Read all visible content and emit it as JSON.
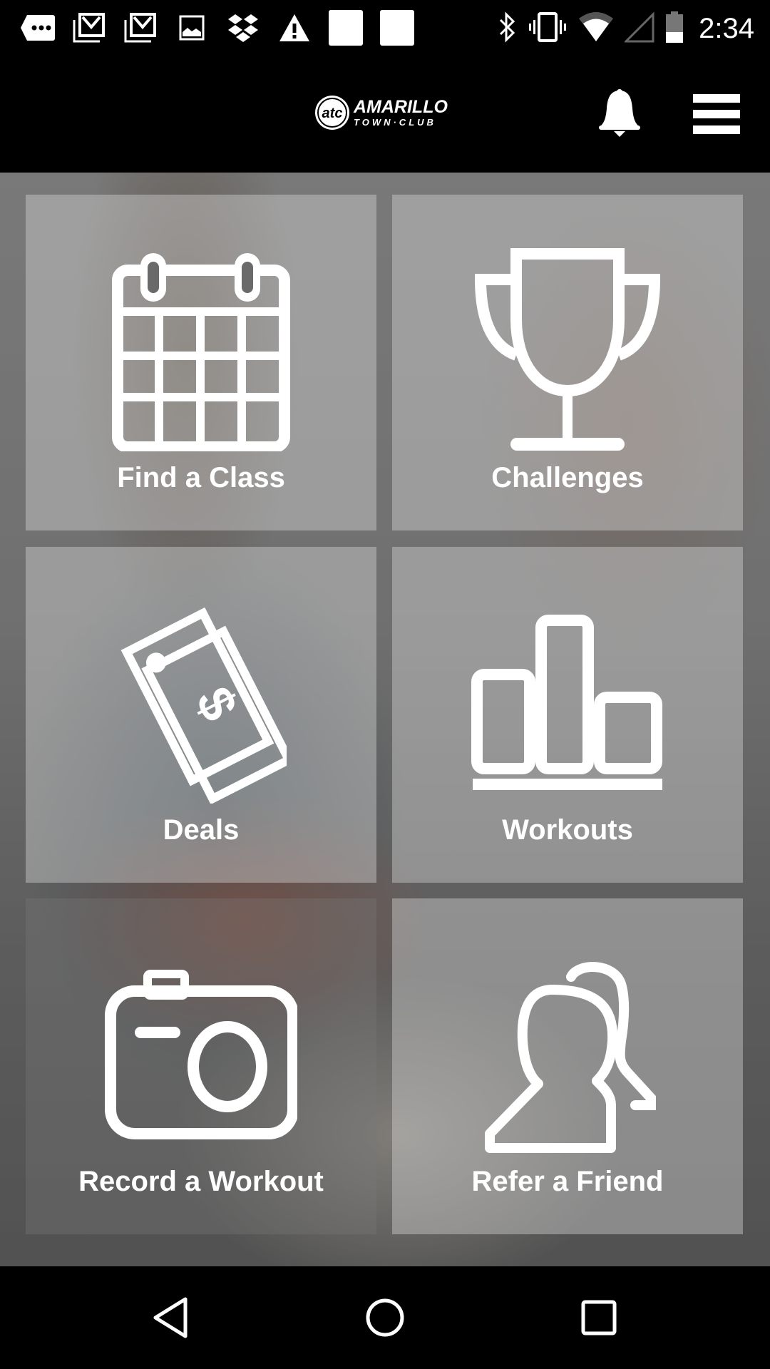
{
  "status_bar": {
    "notification_icons": [
      "more-messages-icon",
      "gmail-icon",
      "gmail-icon",
      "image-icon",
      "dropbox-icon",
      "warning-icon",
      "blank-notification-icon",
      "blank-notification-icon"
    ],
    "system_icons": [
      "bluetooth-icon",
      "vibrate-icon",
      "wifi-icon",
      "cell-signal-icon",
      "battery-icon"
    ],
    "time": "2:34"
  },
  "header": {
    "logo_text_main": "AMARILLO",
    "logo_text_sub": "TOWN·CLUB",
    "logo_badge": "atc"
  },
  "tiles": [
    {
      "label": "Find a Class",
      "icon": "calendar-icon"
    },
    {
      "label": "Challenges",
      "icon": "trophy-icon"
    },
    {
      "label": "Deals",
      "icon": "price-tag-icon"
    },
    {
      "label": "Workouts",
      "icon": "bar-chart-icon"
    },
    {
      "label": "Record a Workout",
      "icon": "camera-icon"
    },
    {
      "label": "Refer a Friend",
      "icon": "users-icon"
    }
  ],
  "nav_bar": {
    "buttons": [
      "back",
      "home",
      "recents"
    ]
  }
}
